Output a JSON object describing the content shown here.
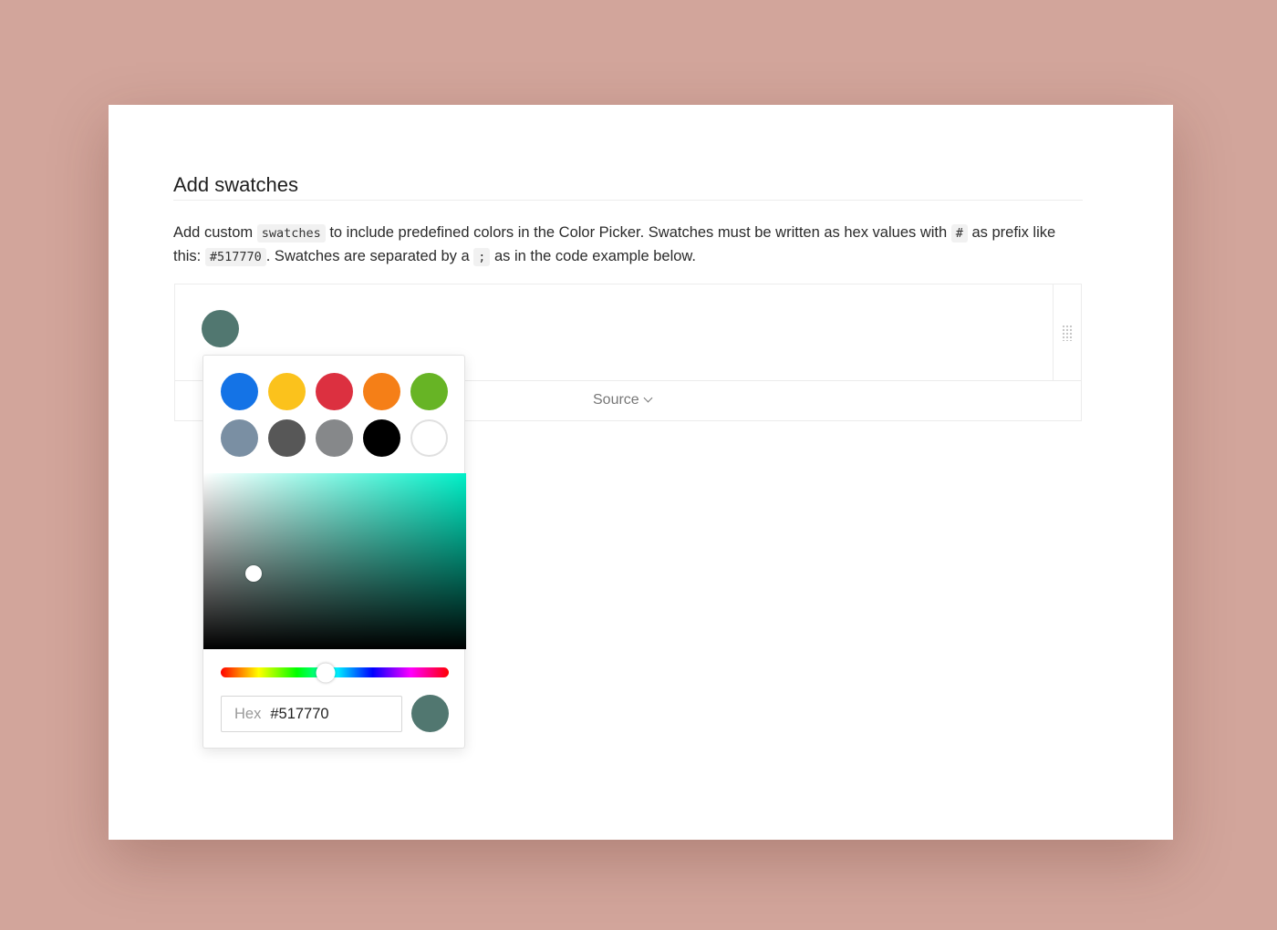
{
  "section": {
    "title": "Add swatches",
    "description": {
      "p1": "Add custom ",
      "code1": "swatches",
      "p2": " to include predefined colors in the Color Picker. Swatches must be written as hex values with ",
      "code2": "#",
      "p3": " as prefix like this: ",
      "code3": "#517770",
      "p4": ". Swatches are separated by a ",
      "code4": ";",
      "p5": " as in the code example below."
    }
  },
  "example": {
    "source_label": "Source",
    "source_icon": "chevron-down-icon",
    "drag_icon": "drag-handle-icon"
  },
  "picker": {
    "current_color": "#517770",
    "swatches": [
      "#1473e6",
      "#fbc21c",
      "#dc3040",
      "#f57f17",
      "#67b425",
      "#7a8fa3",
      "#575757",
      "#86888a",
      "#000000",
      "#ffffff"
    ],
    "saturation_area": {
      "hue_color": "#00f0c8",
      "saturation": 0.19,
      "brightness": 0.43
    },
    "hue": 165,
    "hex_label": "Hex",
    "hex_value": "#517770"
  }
}
